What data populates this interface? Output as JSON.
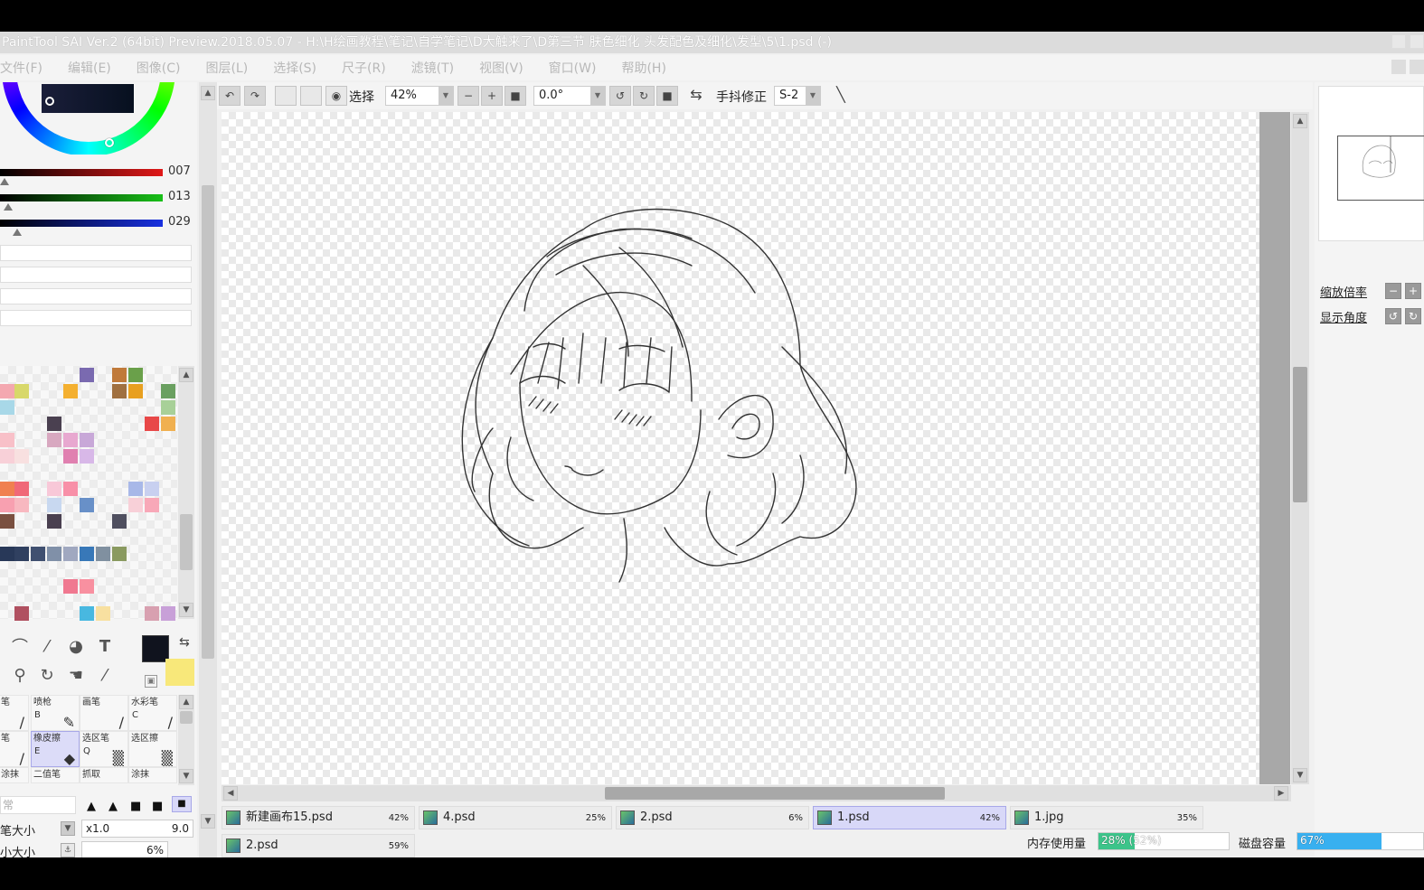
{
  "title": "PaintTool SAI Ver.2 (64bit) Preview.2018.05.07 - H:\\H绘画教程\\笔记\\自学笔记\\D大触来了\\D第三节 肤色细化 头发配色及细化\\发型\\5\\1.psd (-)",
  "menu": [
    "文件(F)",
    "编辑(E)",
    "图像(C)",
    "图层(L)",
    "选择(S)",
    "尺子(R)",
    "滤镜(T)",
    "视图(V)",
    "窗口(W)",
    "帮助(H)"
  ],
  "colors": {
    "accent_selection": "#d8d8f8",
    "foreground": "#10131e",
    "background": "#f8e87a",
    "memory_bar": "#3cc48a",
    "disk_bar": "#38b0f0"
  },
  "color_panel": {
    "sliders": [
      {
        "channel": "red",
        "value": "007",
        "color": "#e01818"
      },
      {
        "channel": "green",
        "value": "013",
        "color": "#18c018"
      },
      {
        "channel": "blue",
        "value": "029",
        "color": "#1830e0"
      }
    ]
  },
  "toolbar": {
    "select_label": "选择",
    "zoom": "42%",
    "angle": "0.0°",
    "stabilizer_label": "手抖修正",
    "stabilizer_value": "S-2"
  },
  "brush_tools": [
    {
      "name": "笔",
      "key": ""
    },
    {
      "name": "喷枪",
      "key": "B"
    },
    {
      "name": "画笔",
      "key": ""
    },
    {
      "name": "水彩笔",
      "key": "C"
    },
    {
      "name": "笔",
      "key": ""
    },
    {
      "name": "橡皮擦",
      "key": "E"
    },
    {
      "name": "选区笔",
      "key": "Q"
    },
    {
      "name": "选区擦",
      "key": ""
    },
    {
      "name": "涂抹",
      "key": ""
    },
    {
      "name": "二值笔",
      "key": ""
    },
    {
      "name": "抓取",
      "key": ""
    },
    {
      "name": "涂抹",
      "key": ""
    }
  ],
  "brush_params": {
    "mode": "常",
    "size_label": "笔大小",
    "size_multiplier": "x1.0",
    "size_value": "9.0",
    "min_size_label": "小大小",
    "min_size_value": "6%"
  },
  "file_tabs": [
    {
      "name": "新建画布15.psd",
      "zoom": "42%",
      "active": false
    },
    {
      "name": "4.psd",
      "zoom": "25%",
      "active": false
    },
    {
      "name": "2.psd",
      "zoom": "6%",
      "active": false
    },
    {
      "name": "1.psd",
      "zoom": "42%",
      "active": true
    },
    {
      "name": "1.jpg",
      "zoom": "35%",
      "active": false
    },
    {
      "name": "2.psd",
      "zoom": "59%",
      "active": false
    }
  ],
  "navigator": {
    "zoom_label": "缩放倍率",
    "angle_label": "显示角度"
  },
  "status": {
    "memory_label": "内存使用量",
    "memory_value": "28% (52%)",
    "memory_fraction": 0.28,
    "disk_label": "磁盘容量",
    "disk_value": "67%",
    "disk_fraction": 0.67
  }
}
